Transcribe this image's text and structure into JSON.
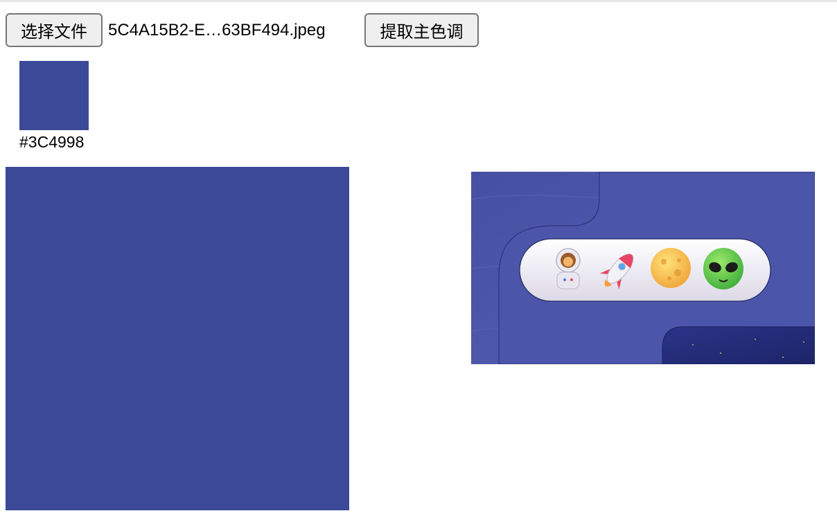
{
  "toolbar": {
    "choose_file_label": "选择文件",
    "file_name": "5C4A15B2-E…63BF494.jpeg",
    "extract_label": "提取主色调"
  },
  "result": {
    "color_hex": "#3C4998",
    "color_label": "#3C4998"
  },
  "image": {
    "emoji": [
      "astronaut",
      "rocket",
      "moon",
      "alien"
    ],
    "bg_color": "#4c56a8",
    "pill_color": "#f4f2f7"
  }
}
